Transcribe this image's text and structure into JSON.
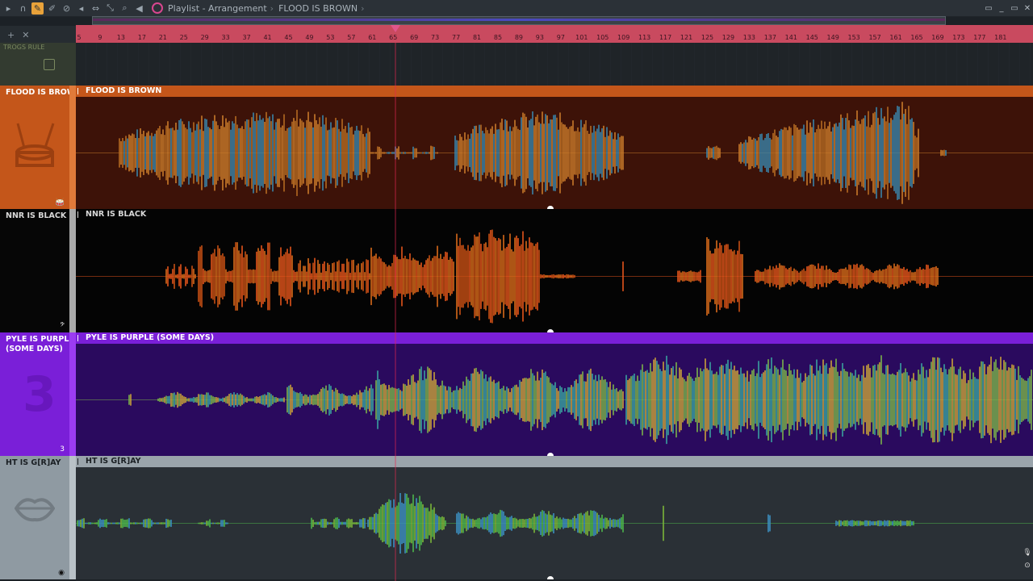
{
  "titlebar": {
    "title": "Playlist - Arrangement",
    "separator": "›",
    "current_pattern": "FLOOD IS BROWN",
    "tool_icons": [
      "menu-arrow-icon",
      "magnet-icon",
      "pencil-icon",
      "paint-icon",
      "mute-icon",
      "slip-icon",
      "slice-icon",
      "select-icon",
      "zoom-icon",
      "speaker-icon"
    ],
    "window_controls": [
      "▭",
      "_",
      "▭",
      "✕"
    ]
  },
  "toolstrip": {
    "plus": "+",
    "cross": "✕"
  },
  "pattern_row": {
    "label": "TROGS RULE"
  },
  "ruler": {
    "bars": [
      "5",
      "9",
      "13",
      "17",
      "21",
      "25",
      "29",
      "33",
      "37",
      "41",
      "45",
      "49",
      "53",
      "57",
      "61",
      "65",
      "69",
      "73",
      "77",
      "81",
      "85",
      "89",
      "93",
      "97",
      "101",
      "105",
      "109",
      "113",
      "117",
      "121",
      "125",
      "129",
      "133",
      "137",
      "141",
      "145",
      "149",
      "153",
      "157",
      "161",
      "165",
      "169",
      "173",
      "177",
      "181"
    ]
  },
  "tracks": [
    {
      "id": "flood",
      "header_name": "FLOOD IS BROWN",
      "clip_name": "FLOOD IS BROWN",
      "header_bg": "#c4561a",
      "stripe": "#e07a3a",
      "lane_bg": "#3d1208",
      "clip_head_bg": "#c4561a",
      "text_color": "#ffffff",
      "icon": "drum-icon",
      "mini_icon": "drum-mini-icon",
      "mini_glyph": "🥁",
      "wave_colors": [
        "#c87a2a",
        "#b56a22",
        "#3a84a8"
      ]
    },
    {
      "id": "nnr",
      "header_name": "NNR IS BLACK",
      "clip_name": "NNR IS BLACK",
      "header_bg": "#060606",
      "stripe": "#a9a9a9",
      "lane_bg": "#040404",
      "clip_head_bg": "#040404",
      "text_color": "#d8d8d8",
      "icon": "none",
      "mini_icon": "bass-clef-icon",
      "mini_glyph": "𝄢",
      "wave_colors": [
        "#e4541c",
        "#d86a1a",
        "#c85014"
      ]
    },
    {
      "id": "pyle",
      "header_name": "PYLE IS PURPLE\n(SOME DAYS)",
      "clip_name": "PYLE IS PURPLE (SOME DAYS)",
      "header_bg": "#7a1fd8",
      "stripe": "#9b3cf2",
      "lane_bg": "#2a0a5e",
      "clip_head_bg": "#7a1fd8",
      "text_color": "#ffffff",
      "icon": "three-icon",
      "mini_icon": "three-mini-icon",
      "mini_glyph": "3",
      "wave_colors": [
        "#7ab24a",
        "#3aa0a0",
        "#c8a03a"
      ]
    },
    {
      "id": "ht",
      "header_name": "HT IS G[R]AY",
      "clip_name": "HT IS G[R]AY",
      "header_bg": "#8f9aa2",
      "stripe": "#b9c2c8",
      "lane_bg": "#2a3036",
      "clip_head_bg": "#9aa4ab",
      "text_color": "#1a1f23",
      "icon": "lips-icon",
      "mini_icon": "lips-mini-icon",
      "mini_glyph": "◉",
      "wave_colors": [
        "#4cb54c",
        "#3b8fc0",
        "#7ab53a"
      ]
    }
  ],
  "right_dock": {
    "mic": "🎙",
    "globe": "⊙"
  }
}
